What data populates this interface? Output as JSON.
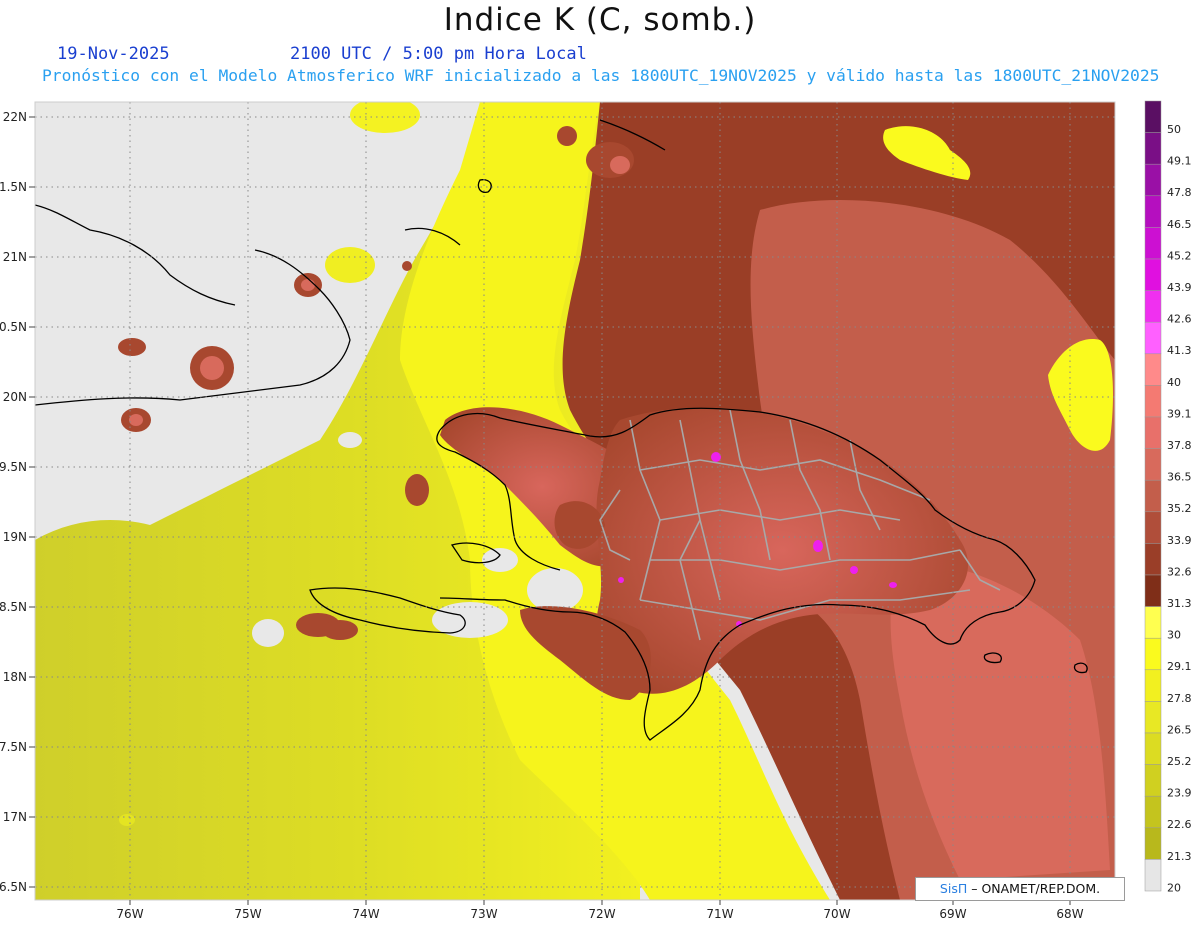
{
  "header": {
    "title": "Indice K (C, somb.)",
    "date": "19-Nov-2025",
    "time": "2100 UTC / 5:00 pm Hora Local",
    "subtitle": "Pronóstico con el Modelo Atmosferico WRF inicializado a las 1800UTC_19NOV2025 y válido hasta las  1800UTC_21NOV2025"
  },
  "map": {
    "lat_labels": [
      "22N",
      "1.5N",
      "21N",
      "0.5N",
      "20N",
      "9.5N",
      "19N",
      "8.5N",
      "18N",
      "7.5N",
      "17N",
      "6.5N"
    ],
    "lon_labels": [
      "76W",
      "75W",
      "74W",
      "73W",
      "72W",
      "71W",
      "70W",
      "69W",
      "68W"
    ],
    "land_fill": "#e6e6e6",
    "coast_color": "#000000",
    "province_color": "#a8a8a8"
  },
  "colorbar": {
    "labels": [
      "50",
      "49.1",
      "47.8",
      "46.5",
      "45.2",
      "43.9",
      "42.6",
      "41.3",
      "40",
      "39.1",
      "37.8",
      "36.5",
      "35.2",
      "33.9",
      "32.6",
      "31.3",
      "30",
      "29.1",
      "27.8",
      "26.5",
      "25.2",
      "23.9",
      "22.6",
      "21.3",
      "20"
    ],
    "colors": [
      "#5a0f63",
      "#7a0f86",
      "#9a10a6",
      "#b50fbf",
      "#cc10d2",
      "#e010e0",
      "#f030f0",
      "#ff60ff",
      "#ff8a8a",
      "#f47a72",
      "#e8706a",
      "#d86a5c",
      "#c35e4b",
      "#b04e3a",
      "#9a3e28",
      "#7f2e18",
      "#ffff50",
      "#fafa1e",
      "#f2f020",
      "#e8e824",
      "#dcdc22",
      "#d0d020",
      "#c4c41e",
      "#b8b81c",
      "#e6e6e6"
    ]
  },
  "credit": {
    "brand": "SisΠ",
    "text": "– ONAMET/REP.DOM."
  }
}
